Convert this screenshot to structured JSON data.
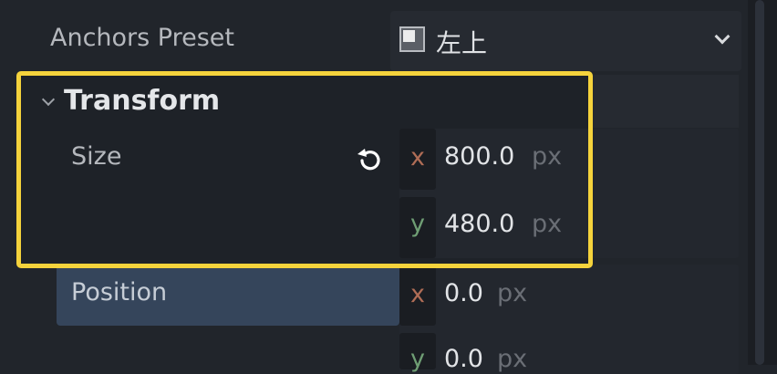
{
  "anchors_preset": {
    "label": "Anchors Preset",
    "value": "左上",
    "icon": "anchor-top-left-icon"
  },
  "transform": {
    "title": "Transform",
    "size": {
      "label": "Size",
      "x_axis": "x",
      "x_value": "800.0",
      "y_axis": "y",
      "y_value": "480.0",
      "unit": "px"
    },
    "position": {
      "label": "Position",
      "x_axis": "x",
      "x_value": "0.0",
      "y_axis": "y",
      "y_value": "0.0",
      "unit": "px"
    }
  },
  "colors": {
    "highlight": "#f5d33c",
    "axis_x": "#b06d56",
    "axis_y": "#6f9e74",
    "selected_row": "#35455b"
  }
}
